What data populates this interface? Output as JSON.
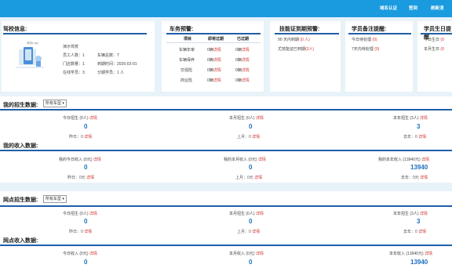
{
  "top_links": [
    "域名认证",
    "签到",
    "刷新消"
  ],
  "school_card": {
    "title": "驾校信息:",
    "logo_text": "驾校Logo",
    "name": "演示驾校",
    "staff": "员工人数：1",
    "vehicles": "车辆总数：T",
    "stores": "门店数量：1",
    "expire": "到期时间：2026-02-01",
    "students": "在线学员：3",
    "period": "分期学员：1 人"
  },
  "vehicle_alert": {
    "title": "车务预警:",
    "headers": [
      "项目",
      "即将过期",
      "已过期"
    ],
    "rows": [
      {
        "item": "车辆年审",
        "soon": "0辆",
        "soon_link": "详情",
        "past": "0辆",
        "past_link": "详情"
      },
      {
        "item": "车辆保养",
        "soon": "0辆",
        "soon_link": "详情",
        "past": "0辆",
        "past_link": "详情"
      },
      {
        "item": "交强险",
        "soon": "0辆",
        "soon_link": "详情",
        "past": "0辆",
        "past_link": "详情"
      },
      {
        "item": "商业险",
        "soon": "0辆",
        "soon_link": "详情",
        "past": "0辆",
        "past_link": "详情"
      }
    ]
  },
  "cert_alert": {
    "title": "技能证到期预警:",
    "line1": "90 天内到期",
    "line1_red": "(0 人)",
    "line2": "尤技能证已到期",
    "line2_red": "(3人)"
  },
  "student_followup": {
    "title": "学员备注提醒:",
    "line1": "今日待处理",
    "line1_red": "(0)",
    "line2": "7天内待处理",
    "line2_red": "(0)"
  },
  "birthday": {
    "title": "学员生日提醒",
    "line1": "今日生日",
    "line1_red": "(0",
    "line2": "本月生日",
    "line2_red": "(0"
  },
  "my_enroll": {
    "title": "我的招生数据:",
    "select": "所有车型",
    "cols": [
      {
        "label": "今日招生 (0人)",
        "link": "详情",
        "value": "0",
        "sub": "昨日：0",
        "sub_link": "详情"
      },
      {
        "label": "本月招生 (0人)",
        "link": "详情",
        "value": "0",
        "sub": "上月：0",
        "sub_link": "详情"
      },
      {
        "label": "本年招生 (3人)",
        "link": "详情",
        "value": "3",
        "sub": "去年：0",
        "sub_link": "详情"
      }
    ]
  },
  "my_income": {
    "title": "我的收入数据:",
    "cols": [
      {
        "label": "我的今日收入 (0元)",
        "link": "详情",
        "value": "0",
        "sub": "昨日：0元",
        "sub_link": "详情"
      },
      {
        "label": "我的本月收入 (0元)",
        "link": "详情",
        "value": "0",
        "sub": "上月：0元",
        "sub_link": "详情"
      },
      {
        "label": "我的本年收入 (13940元)",
        "link": "详情",
        "value": "13940",
        "sub": "去年：0元",
        "sub_link": "详情"
      }
    ]
  },
  "branch_enroll": {
    "title": "网点招生数据:",
    "select": "所有车型",
    "cols": [
      {
        "label": "今日招生 (0人)",
        "link": "详情",
        "value": "0",
        "sub": "昨日：0",
        "sub_link": "详情"
      },
      {
        "label": "本月招生 (0人)",
        "link": "详情",
        "value": "0",
        "sub": "上月：0",
        "sub_link": "详情"
      },
      {
        "label": "本年招生 (3人)",
        "link": "详情",
        "value": "3",
        "sub": "去年：0",
        "sub_link": "详情"
      }
    ]
  },
  "branch_income": {
    "title": "网点收入数据:",
    "cols": [
      {
        "label": "今日收入 (0元)",
        "link": "详情",
        "value": "0"
      },
      {
        "label": "本月收入 (0元)",
        "link": "详情",
        "value": "0"
      },
      {
        "label": "本年收入 (13940元)",
        "link": "详情",
        "value": "13940"
      }
    ]
  }
}
